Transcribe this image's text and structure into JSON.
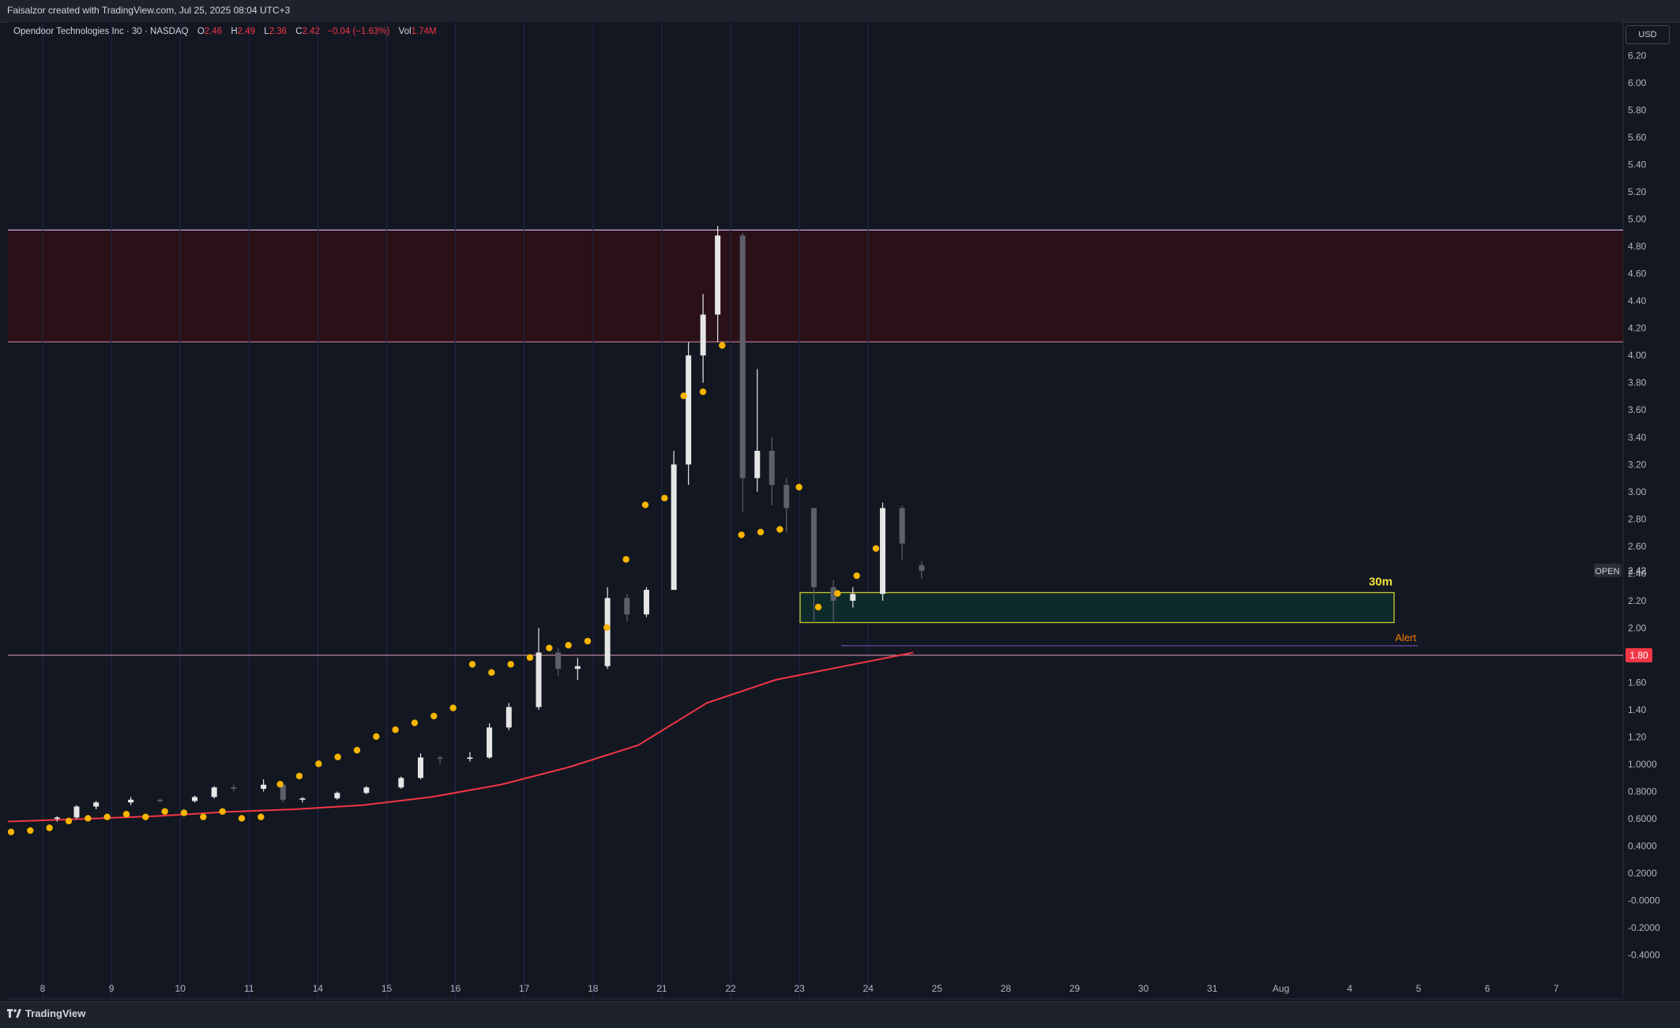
{
  "header": {
    "credit": "Faisalzor created with TradingView.com, Jul 25, 2025 08:04 UTC+3"
  },
  "legend": {
    "symbol": "Opendoor Technologies Inc · 30 · NASDAQ",
    "o_label": "O",
    "o": "2.46",
    "h_label": "H",
    "h": "2.49",
    "l_label": "L",
    "l": "2.36",
    "c_label": "C",
    "c": "2.42",
    "change": "−0.04 (−1.63%)",
    "vol_label": "Vol",
    "vol": "1.74M"
  },
  "currency": "USD",
  "footer": {
    "brand": "TradingView"
  },
  "colors": {
    "background": "#131722",
    "bull_candle": "#e6e6e6",
    "bear_candle": "#5d606b",
    "ma_line": "#f23645",
    "signal_dot": "#f7b500",
    "resistance_zone": "#2a1118",
    "support_box_border": "#c9c930",
    "alert_label": "#f57c00",
    "price_tag": "#f23645"
  },
  "chart_data": {
    "type": "candlestick",
    "x_tick_labels": [
      "8",
      "9",
      "10",
      "11",
      "14",
      "15",
      "16",
      "17",
      "18",
      "21",
      "22",
      "23",
      "24",
      "25",
      "28",
      "29",
      "30",
      "31",
      "Aug",
      "4",
      "5",
      "6",
      "7"
    ],
    "y_tick_labels": [
      "6.20",
      "6.00",
      "5.80",
      "5.60",
      "5.40",
      "5.20",
      "5.00",
      "4.80",
      "4.60",
      "4.40",
      "4.20",
      "4.00",
      "3.80",
      "3.60",
      "3.40",
      "3.20",
      "3.00",
      "2.80",
      "2.60",
      "2.40",
      "2.20",
      "2.00",
      "1.80",
      "1.60",
      "1.40",
      "1.20",
      "1.0000",
      "0.8000",
      "0.6000",
      "0.4000",
      "0.2000",
      "-0.0000",
      "-0.2000",
      "-0.4000"
    ],
    "ylim": [
      -0.5,
      6.25
    ],
    "session_days": [
      "8",
      "9",
      "10",
      "11",
      "14",
      "15",
      "16",
      "17",
      "18",
      "21",
      "22",
      "23",
      "24"
    ],
    "candles_ohlc": [
      [
        "8",
        0.6,
        0.62,
        0.58,
        0.61
      ],
      [
        "8",
        0.61,
        0.7,
        0.6,
        0.69
      ],
      [
        "8",
        0.69,
        0.73,
        0.67,
        0.72
      ],
      [
        "9",
        0.72,
        0.76,
        0.7,
        0.74
      ],
      [
        "9",
        0.74,
        0.75,
        0.72,
        0.73
      ],
      [
        "10",
        0.73,
        0.77,
        0.72,
        0.76
      ],
      [
        "10",
        0.76,
        0.84,
        0.75,
        0.83
      ],
      [
        "10",
        0.83,
        0.85,
        0.8,
        0.82
      ],
      [
        "11",
        0.82,
        0.89,
        0.8,
        0.85
      ],
      [
        "11",
        0.85,
        0.86,
        0.72,
        0.74
      ],
      [
        "11",
        0.74,
        0.76,
        0.72,
        0.75
      ],
      [
        "14",
        0.75,
        0.8,
        0.74,
        0.79
      ],
      [
        "14",
        0.79,
        0.84,
        0.78,
        0.83
      ],
      [
        "15",
        0.83,
        0.91,
        0.82,
        0.9
      ],
      [
        "15",
        0.9,
        1.08,
        0.89,
        1.05
      ],
      [
        "15",
        1.05,
        1.06,
        1.0,
        1.04
      ],
      [
        "16",
        1.04,
        1.09,
        1.02,
        1.05
      ],
      [
        "16",
        1.05,
        1.3,
        1.04,
        1.27
      ],
      [
        "16",
        1.27,
        1.45,
        1.25,
        1.42
      ],
      [
        "17",
        1.42,
        2.0,
        1.4,
        1.82
      ],
      [
        "17",
        1.82,
        1.85,
        1.65,
        1.7
      ],
      [
        "17",
        1.7,
        1.78,
        1.62,
        1.72
      ],
      [
        "18",
        1.72,
        2.3,
        1.7,
        2.22
      ],
      [
        "18",
        2.22,
        2.25,
        2.05,
        2.1
      ],
      [
        "18",
        2.1,
        2.3,
        2.08,
        2.28
      ],
      [
        "21",
        2.28,
        3.3,
        2.65,
        3.2
      ],
      [
        "21",
        3.2,
        4.1,
        3.05,
        4.0
      ],
      [
        "21",
        4.0,
        4.45,
        3.8,
        4.3
      ],
      [
        "21",
        4.3,
        4.95,
        4.1,
        4.88
      ],
      [
        "22",
        4.88,
        4.9,
        2.85,
        3.1
      ],
      [
        "22",
        3.1,
        3.9,
        3.0,
        3.3
      ],
      [
        "22",
        3.3,
        3.4,
        2.9,
        3.05
      ],
      [
        "22",
        3.05,
        3.1,
        2.7,
        2.88
      ],
      [
        "23",
        2.88,
        2.55,
        2.05,
        2.3
      ],
      [
        "23",
        2.3,
        2.35,
        2.05,
        2.2
      ],
      [
        "23",
        2.2,
        2.3,
        2.15,
        2.25
      ],
      [
        "24",
        2.25,
        2.92,
        2.2,
        2.88
      ],
      [
        "24",
        2.88,
        2.9,
        2.5,
        2.62
      ],
      [
        "24",
        2.46,
        2.49,
        2.36,
        2.42
      ]
    ],
    "moving_average": [
      [
        "8",
        0.58
      ],
      [
        "9",
        0.6
      ],
      [
        "10",
        0.62
      ],
      [
        "11",
        0.65
      ],
      [
        "14",
        0.67
      ],
      [
        "15",
        0.7
      ],
      [
        "16",
        0.76
      ],
      [
        "17",
        0.85
      ],
      [
        "18",
        0.98
      ],
      [
        "21",
        1.14
      ],
      [
        "22",
        1.45
      ],
      [
        "23",
        1.62
      ],
      [
        "24",
        1.72
      ],
      [
        "25",
        1.82
      ]
    ],
    "signal_dots_y": [
      0.55,
      0.56,
      0.58,
      0.63,
      0.65,
      0.66,
      0.68,
      0.66,
      0.7,
      0.69,
      0.66,
      0.7,
      0.65,
      0.66,
      0.9,
      0.96,
      1.05,
      1.1,
      1.15,
      1.25,
      1.3,
      1.35,
      1.4,
      1.46,
      1.78,
      1.72,
      1.78,
      1.83,
      1.9,
      1.92,
      1.95,
      2.05,
      2.55,
      2.95,
      3.0,
      3.75,
      3.78,
      4.12,
      2.73,
      2.75,
      2.77,
      3.08,
      2.2,
      2.3,
      2.43,
      2.63
    ],
    "resistance_zone": {
      "low": 4.1,
      "high": 4.92
    },
    "support_box": {
      "low": 2.04,
      "high": 2.26,
      "label": "30m"
    },
    "alert_line": {
      "price": 1.87,
      "label": "Alert"
    },
    "horizontal_line": {
      "price": 1.8,
      "label": "1.80"
    },
    "open_price_tag": {
      "label": "OPEN",
      "price": "2.42"
    }
  }
}
